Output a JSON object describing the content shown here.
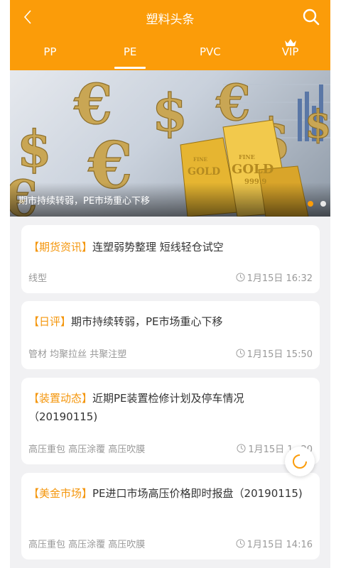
{
  "header": {
    "title": "塑料头条",
    "back_icon": "chevron-left-icon",
    "search_icon": "search-icon"
  },
  "tabs": [
    {
      "label": "PP",
      "active": false
    },
    {
      "label": "PE",
      "active": true
    },
    {
      "label": "PVC",
      "active": false
    },
    {
      "label": "VIP",
      "active": false,
      "icon": "crown-icon"
    }
  ],
  "banner": {
    "caption": "期市持续转弱，PE市场重心下移",
    "dots": 2,
    "active_dot": 0,
    "image_text": [
      "FINE",
      "GOLD",
      "999.9",
      "FINE",
      "GOLD"
    ]
  },
  "articles": [
    {
      "category": "【期货资讯】",
      "title": "连塑弱势整理 短线轻仓试空",
      "tags": "线型",
      "time": "1月15日 16:32"
    },
    {
      "category": "【日评】",
      "title": "期市持续转弱，PE市场重心下移",
      "tags": "管材 均聚拉丝 共聚注塑",
      "time": "1月15日 15:50"
    },
    {
      "category": "【装置动态】",
      "title": "近期PE装置检修计划及停车情况（20190115)",
      "tags": "高压重包 高压涂覆 高压吹膜",
      "time": "1月15日 1_:20"
    },
    {
      "category": "【美金市场】",
      "title": "PE进口市场高压价格即时报盘（20190115)",
      "tags": "高压重包 高压涂覆 高压吹膜",
      "time": "1月15日 14:16"
    }
  ],
  "colors": {
    "accent": "#fb9c09",
    "category": "#f4960c",
    "background": "#f1f1f3"
  },
  "fab": {
    "icon": "refresh-icon"
  }
}
